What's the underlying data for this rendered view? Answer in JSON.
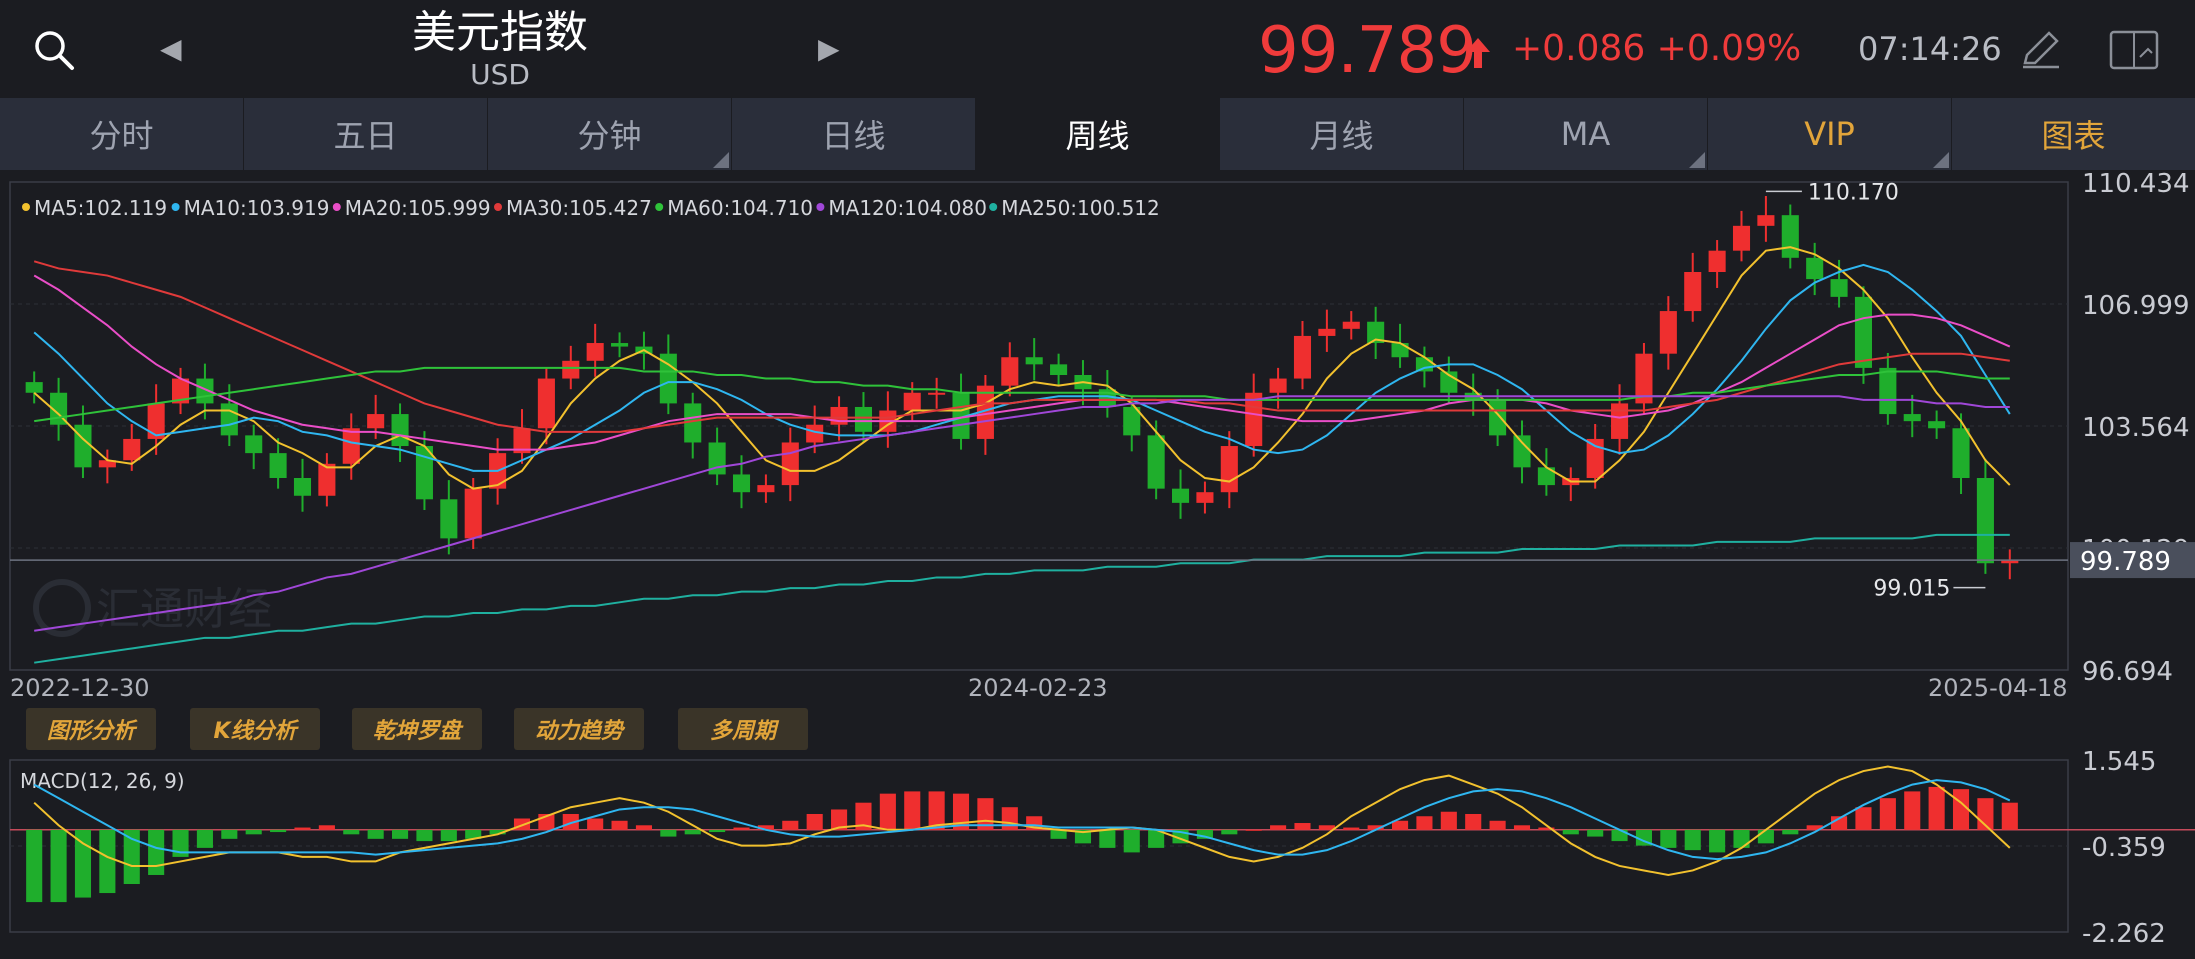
{
  "header": {
    "title": "美元指数",
    "subtitle": "USD",
    "price": "99.789",
    "change": "+0.086 +0.09%",
    "time": "07:14:26"
  },
  "tabs": [
    {
      "label": "分时",
      "state": "normal"
    },
    {
      "label": "五日",
      "state": "normal"
    },
    {
      "label": "分钟",
      "state": "dropdown"
    },
    {
      "label": "日线",
      "state": "normal"
    },
    {
      "label": "周线",
      "state": "active"
    },
    {
      "label": "月线",
      "state": "normal"
    },
    {
      "label": "MA",
      "state": "dropdown"
    },
    {
      "label": "VIP",
      "state": "gold-dropdown"
    },
    {
      "label": "图表",
      "state": "gold"
    }
  ],
  "feature_buttons": [
    "图形分析",
    "K线分析",
    "乾坤罗盘",
    "动力趋势",
    "多周期"
  ],
  "watermark": "汇通财经",
  "colors": {
    "up": "#ef2f2f",
    "down": "#1fae2c",
    "accent_gold": "#e2a53a",
    "price_red": "#ef3b3b"
  },
  "chart_data": [
    {
      "type": "candlestick",
      "name": "main",
      "period": "weekly",
      "date_labels": [
        "2022-12-30",
        "2024-02-23",
        "2025-04-18"
      ],
      "ylim": [
        96.694,
        110.434
      ],
      "y_ticks": [
        "110.434",
        "106.999",
        "103.564",
        "100.129",
        "96.694"
      ],
      "current_price_label": "99.789",
      "high_marker": "110.170",
      "low_marker": "99.015",
      "ma_legend": [
        {
          "label": "MA5:102.119",
          "color": "#f2c12e"
        },
        {
          "label": "MA10:103.919",
          "color": "#2fb6f0"
        },
        {
          "label": "MA20:105.999",
          "color": "#ea4ec8"
        },
        {
          "label": "MA30:105.427",
          "color": "#e03a3a"
        },
        {
          "label": "MA60:104.710",
          "color": "#2fc23a"
        },
        {
          "label": "MA120:104.080",
          "color": "#a047d8"
        },
        {
          "label": "MA250:100.512",
          "color": "#1fb0a0"
        }
      ],
      "close_path": [
        104.5,
        103.6,
        102.4,
        102.6,
        103.2,
        104.2,
        104.9,
        104.2,
        103.3,
        102.8,
        102.1,
        101.6,
        102.5,
        103.5,
        103.9,
        103.0,
        101.5,
        100.4,
        101.8,
        102.8,
        103.5,
        104.9,
        105.4,
        105.9,
        105.8,
        105.6,
        104.2,
        103.1,
        102.2,
        101.7,
        101.9,
        103.1,
        103.6,
        104.1,
        103.4,
        104.0,
        104.5,
        104.5,
        103.2,
        104.7,
        105.5,
        105.3,
        105.0,
        104.6,
        104.1,
        103.3,
        101.8,
        101.4,
        101.7,
        103.0,
        104.5,
        104.9,
        106.1,
        106.3,
        106.5,
        105.9,
        105.5,
        105.1,
        104.5,
        104.3,
        103.3,
        102.4,
        101.9,
        102.1,
        103.2,
        104.2,
        105.6,
        106.8,
        107.9,
        108.5,
        109.2,
        109.5,
        108.3,
        107.7,
        107.2,
        105.2,
        103.9,
        103.7,
        103.5,
        102.1,
        99.7,
        99.79
      ],
      "ma5": [
        104.5,
        103.9,
        103.2,
        102.6,
        102.5,
        103.0,
        103.6,
        104.0,
        104.0,
        103.7,
        103.1,
        102.8,
        102.4,
        102.4,
        103.0,
        103.3,
        103.0,
        102.2,
        101.8,
        101.9,
        102.3,
        103.2,
        104.2,
        104.9,
        105.4,
        105.7,
        105.3,
        104.8,
        104.2,
        103.4,
        102.6,
        102.3,
        102.3,
        102.6,
        103.1,
        103.6,
        104.0,
        104.0,
        104.0,
        104.2,
        104.6,
        104.8,
        104.7,
        104.8,
        104.7,
        104.2,
        103.4,
        102.6,
        102.1,
        102.0,
        102.4,
        103.1,
        103.9,
        104.9,
        105.6,
        106.0,
        105.9,
        105.5,
        105.0,
        104.6,
        103.9,
        103.1,
        102.4,
        102.0,
        102.0,
        102.6,
        103.4,
        104.5,
        105.6,
        106.7,
        107.8,
        108.5,
        108.6,
        108.4,
        108.0,
        107.4,
        106.6,
        105.5,
        104.5,
        103.7,
        102.6,
        101.9
      ],
      "ma10": [
        106.2,
        105.6,
        104.9,
        104.2,
        103.7,
        103.3,
        103.4,
        103.5,
        103.6,
        103.8,
        103.7,
        103.4,
        103.3,
        103.1,
        103.0,
        102.9,
        102.7,
        102.5,
        102.3,
        102.3,
        102.6,
        102.9,
        103.2,
        103.6,
        104.0,
        104.5,
        104.8,
        104.8,
        104.6,
        104.3,
        103.9,
        103.6,
        103.4,
        103.3,
        103.3,
        103.3,
        103.4,
        103.6,
        103.8,
        104.0,
        104.2,
        104.3,
        104.4,
        104.4,
        104.4,
        104.3,
        104.0,
        103.7,
        103.4,
        103.2,
        102.9,
        102.8,
        102.9,
        103.3,
        103.9,
        104.5,
        104.9,
        105.2,
        105.3,
        105.3,
        105.0,
        104.6,
        104.0,
        103.4,
        103.0,
        102.8,
        102.9,
        103.3,
        103.9,
        104.6,
        105.4,
        106.3,
        107.1,
        107.6,
        107.9,
        108.1,
        107.9,
        107.4,
        106.8,
        106.1,
        105.0,
        103.9
      ],
      "ma20": [
        107.8,
        107.4,
        106.9,
        106.4,
        105.8,
        105.3,
        104.9,
        104.6,
        104.3,
        104.0,
        103.8,
        103.6,
        103.5,
        103.4,
        103.4,
        103.3,
        103.2,
        103.1,
        103.0,
        102.9,
        102.9,
        102.9,
        103.0,
        103.1,
        103.3,
        103.5,
        103.7,
        103.8,
        103.9,
        103.9,
        103.9,
        103.9,
        103.8,
        103.7,
        103.7,
        103.7,
        103.7,
        103.7,
        103.8,
        103.9,
        104.0,
        104.1,
        104.2,
        104.3,
        104.3,
        104.3,
        104.3,
        104.2,
        104.1,
        104.0,
        103.9,
        103.8,
        103.7,
        103.7,
        103.7,
        103.8,
        103.9,
        104.0,
        104.2,
        104.3,
        104.3,
        104.3,
        104.2,
        104.0,
        103.9,
        103.8,
        103.9,
        104.0,
        104.2,
        104.5,
        104.8,
        105.2,
        105.6,
        106.0,
        106.4,
        106.6,
        106.7,
        106.7,
        106.6,
        106.4,
        106.1,
        105.8
      ],
      "ma30": [
        108.2,
        108.0,
        107.9,
        107.8,
        107.6,
        107.4,
        107.2,
        106.9,
        106.6,
        106.3,
        106.0,
        105.7,
        105.4,
        105.1,
        104.8,
        104.5,
        104.2,
        104.0,
        103.8,
        103.6,
        103.5,
        103.4,
        103.4,
        103.4,
        103.4,
        103.5,
        103.6,
        103.7,
        103.8,
        103.8,
        103.8,
        103.8,
        103.8,
        103.8,
        103.8,
        103.8,
        103.9,
        104.0,
        104.1,
        104.2,
        104.2,
        104.3,
        104.3,
        104.3,
        104.3,
        104.3,
        104.3,
        104.3,
        104.2,
        104.2,
        104.1,
        104.0,
        104.0,
        104.0,
        104.0,
        104.0,
        104.0,
        104.0,
        104.0,
        104.0,
        104.0,
        104.0,
        104.0,
        104.0,
        104.0,
        104.0,
        104.0,
        104.1,
        104.2,
        104.3,
        104.5,
        104.7,
        104.9,
        105.1,
        105.3,
        105.4,
        105.5,
        105.6,
        105.6,
        105.6,
        105.5,
        105.4
      ],
      "ma60": [
        103.7,
        103.8,
        103.9,
        104.0,
        104.1,
        104.2,
        104.3,
        104.4,
        104.5,
        104.6,
        104.7,
        104.8,
        104.9,
        105.0,
        105.1,
        105.1,
        105.2,
        105.2,
        105.2,
        105.2,
        105.2,
        105.2,
        105.2,
        105.2,
        105.2,
        105.1,
        105.1,
        105.1,
        105.0,
        105.0,
        104.9,
        104.9,
        104.8,
        104.8,
        104.7,
        104.7,
        104.6,
        104.6,
        104.5,
        104.5,
        104.5,
        104.5,
        104.5,
        104.5,
        104.5,
        104.4,
        104.4,
        104.4,
        104.4,
        104.3,
        104.3,
        104.3,
        104.3,
        104.3,
        104.3,
        104.3,
        104.3,
        104.3,
        104.3,
        104.3,
        104.3,
        104.3,
        104.3,
        104.3,
        104.3,
        104.3,
        104.4,
        104.4,
        104.5,
        104.5,
        104.6,
        104.7,
        104.8,
        104.9,
        105.0,
        105.0,
        105.1,
        105.1,
        105.1,
        105.0,
        104.9,
        104.9
      ],
      "ma120": [
        97.8,
        97.9,
        98.0,
        98.1,
        98.2,
        98.3,
        98.4,
        98.5,
        98.6,
        98.8,
        98.9,
        99.1,
        99.3,
        99.4,
        99.6,
        99.8,
        100.0,
        100.2,
        100.4,
        100.6,
        100.8,
        101.0,
        101.2,
        101.4,
        101.6,
        101.8,
        102.0,
        102.2,
        102.4,
        102.5,
        102.7,
        102.8,
        103.0,
        103.1,
        103.2,
        103.3,
        103.4,
        103.5,
        103.6,
        103.7,
        103.8,
        103.9,
        104.0,
        104.1,
        104.1,
        104.2,
        104.2,
        104.3,
        104.3,
        104.3,
        104.3,
        104.4,
        104.4,
        104.4,
        104.4,
        104.4,
        104.4,
        104.4,
        104.4,
        104.4,
        104.4,
        104.4,
        104.4,
        104.4,
        104.4,
        104.4,
        104.4,
        104.4,
        104.4,
        104.4,
        104.4,
        104.4,
        104.4,
        104.4,
        104.4,
        104.3,
        104.3,
        104.3,
        104.2,
        104.2,
        104.1,
        104.1
      ],
      "ma250": [
        96.9,
        97.0,
        97.1,
        97.2,
        97.3,
        97.4,
        97.5,
        97.6,
        97.6,
        97.7,
        97.8,
        97.8,
        97.9,
        98.0,
        98.0,
        98.1,
        98.2,
        98.2,
        98.3,
        98.3,
        98.4,
        98.4,
        98.5,
        98.5,
        98.6,
        98.7,
        98.7,
        98.8,
        98.8,
        98.9,
        98.9,
        99.0,
        99.0,
        99.1,
        99.1,
        99.2,
        99.2,
        99.3,
        99.3,
        99.4,
        99.4,
        99.5,
        99.5,
        99.5,
        99.6,
        99.6,
        99.6,
        99.7,
        99.7,
        99.7,
        99.8,
        99.8,
        99.8,
        99.9,
        99.9,
        99.9,
        99.9,
        100.0,
        100.0,
        100.0,
        100.0,
        100.1,
        100.1,
        100.1,
        100.1,
        100.2,
        100.2,
        100.2,
        100.2,
        100.3,
        100.3,
        100.3,
        100.3,
        100.4,
        100.4,
        100.4,
        100.4,
        100.4,
        100.5,
        100.5,
        100.5,
        100.5
      ]
    },
    {
      "type": "bar",
      "name": "MACD(12, 26, 9)",
      "label": "MACD(12, 26, 9)",
      "ylim": [
        -2.262,
        1.545
      ],
      "y_ticks": [
        "1.545",
        "-0.359",
        "-2.262"
      ],
      "histogram": [
        -1.6,
        -1.6,
        -1.5,
        -1.4,
        -1.2,
        -1.0,
        -0.6,
        -0.4,
        -0.2,
        -0.1,
        -0.05,
        0.05,
        0.1,
        -0.1,
        -0.2,
        -0.2,
        -0.25,
        -0.25,
        -0.2,
        -0.1,
        0.25,
        0.35,
        0.35,
        0.25,
        0.2,
        0.1,
        -0.15,
        -0.1,
        -0.05,
        0.05,
        0.1,
        0.2,
        0.35,
        0.45,
        0.6,
        0.8,
        0.85,
        0.85,
        0.8,
        0.7,
        0.5,
        0.3,
        -0.2,
        -0.3,
        -0.4,
        -0.5,
        -0.4,
        -0.3,
        -0.2,
        -0.1,
        0.0,
        0.1,
        0.15,
        0.1,
        0.05,
        0.1,
        0.2,
        0.3,
        0.4,
        0.35,
        0.2,
        0.1,
        0.05,
        -0.1,
        -0.15,
        -0.25,
        -0.35,
        -0.4,
        -0.45,
        -0.5,
        -0.4,
        -0.3,
        -0.1,
        0.1,
        0.3,
        0.5,
        0.7,
        0.85,
        0.95,
        0.9,
        0.7,
        0.6
      ],
      "dif": [
        0.6,
        0.1,
        -0.3,
        -0.6,
        -0.8,
        -0.8,
        -0.7,
        -0.6,
        -0.5,
        -0.5,
        -0.5,
        -0.6,
        -0.6,
        -0.7,
        -0.7,
        -0.5,
        -0.4,
        -0.3,
        -0.2,
        -0.1,
        0.1,
        0.3,
        0.5,
        0.6,
        0.7,
        0.6,
        0.4,
        0.1,
        -0.2,
        -0.35,
        -0.35,
        -0.3,
        -0.1,
        0.05,
        0.1,
        0.0,
        0.0,
        0.1,
        0.15,
        0.2,
        0.15,
        0.05,
        0.0,
        -0.05,
        0.0,
        0.05,
        0.0,
        -0.2,
        -0.4,
        -0.6,
        -0.7,
        -0.6,
        -0.4,
        -0.1,
        0.3,
        0.6,
        0.9,
        1.1,
        1.2,
        1.0,
        0.8,
        0.5,
        0.1,
        -0.3,
        -0.6,
        -0.8,
        -0.9,
        -1.0,
        -0.9,
        -0.7,
        -0.4,
        0.0,
        0.4,
        0.8,
        1.1,
        1.3,
        1.4,
        1.3,
        1.0,
        0.6,
        0.1,
        -0.4
      ],
      "dea": [
        1.0,
        0.7,
        0.4,
        0.1,
        -0.2,
        -0.4,
        -0.5,
        -0.5,
        -0.5,
        -0.5,
        -0.5,
        -0.5,
        -0.5,
        -0.5,
        -0.55,
        -0.5,
        -0.45,
        -0.4,
        -0.35,
        -0.3,
        -0.2,
        -0.05,
        0.15,
        0.3,
        0.45,
        0.5,
        0.5,
        0.45,
        0.3,
        0.15,
        0.0,
        -0.1,
        -0.15,
        -0.15,
        -0.1,
        -0.05,
        0.0,
        0.05,
        0.1,
        0.1,
        0.1,
        0.1,
        0.05,
        0.05,
        0.05,
        0.05,
        0.0,
        -0.05,
        -0.15,
        -0.3,
        -0.45,
        -0.55,
        -0.55,
        -0.45,
        -0.25,
        0.0,
        0.25,
        0.5,
        0.7,
        0.85,
        0.9,
        0.85,
        0.7,
        0.5,
        0.25,
        0.0,
        -0.25,
        -0.45,
        -0.6,
        -0.65,
        -0.6,
        -0.5,
        -0.3,
        -0.05,
        0.25,
        0.55,
        0.8,
        1.0,
        1.1,
        1.05,
        0.9,
        0.65
      ]
    }
  ]
}
